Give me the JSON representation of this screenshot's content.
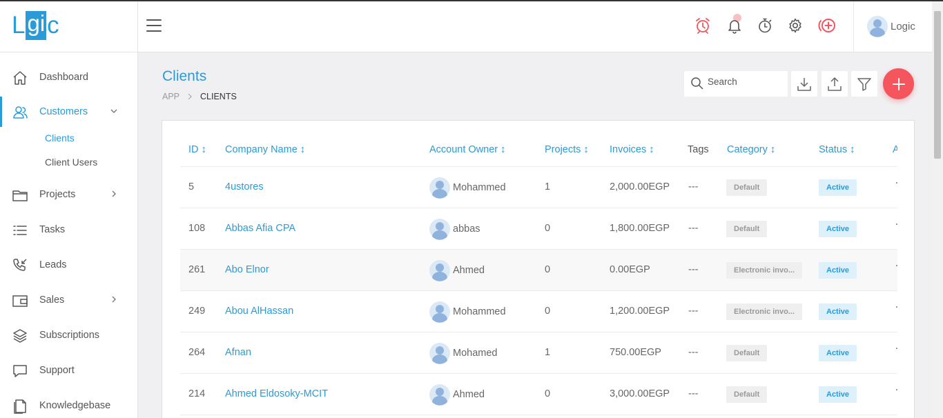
{
  "app": {
    "logo_part1": "L",
    "logo_part2": "gi",
    "logo_part3": "c"
  },
  "header": {
    "user_name": "Logic",
    "icons": [
      "alarm-clock-icon",
      "bell-icon",
      "stopwatch-icon",
      "gear-icon",
      "add-circle-icon"
    ]
  },
  "sidebar": {
    "items": [
      {
        "label": "Dashboard",
        "icon": "home-icon"
      },
      {
        "label": "Customers",
        "icon": "users-icon"
      },
      {
        "label": "Projects",
        "icon": "folder-icon"
      },
      {
        "label": "Tasks",
        "icon": "list-icon"
      },
      {
        "label": "Leads",
        "icon": "phone-icon"
      },
      {
        "label": "Sales",
        "icon": "wallet-icon"
      },
      {
        "label": "Subscriptions",
        "icon": "layers-icon"
      },
      {
        "label": "Support",
        "icon": "chat-icon"
      },
      {
        "label": "Knowledgebase",
        "icon": "book-icon"
      }
    ],
    "sub_items": [
      {
        "label": "Clients"
      },
      {
        "label": "Client Users"
      }
    ]
  },
  "page": {
    "title": "Clients",
    "breadcrumb": [
      "APP",
      "CLIENTS"
    ],
    "search_placeholder": "Search"
  },
  "table": {
    "headers": [
      "ID ↕",
      "Company Name ↕",
      "Account Owner ↕",
      "Projects ↕",
      "Invoices ↕",
      "Tags",
      "Category ↕",
      "Status ↕",
      "A"
    ],
    "rows": [
      {
        "id": "5",
        "company": "4ustores",
        "owner": "Mohammed",
        "projects": "1",
        "invoices": "2,000.00EGP",
        "tags": "---",
        "category": "Default",
        "status": "Active"
      },
      {
        "id": "108",
        "company": "Abbas Afia CPA",
        "owner": "abbas",
        "projects": "0",
        "invoices": "1,800.00EGP",
        "tags": "---",
        "category": "Default",
        "status": "Active"
      },
      {
        "id": "261",
        "company": "Abo Elnor",
        "owner": "Ahmed",
        "projects": "0",
        "invoices": "0.00EGP",
        "tags": "---",
        "category": "Electronic invo...",
        "status": "Active"
      },
      {
        "id": "249",
        "company": "Abou AlHassan",
        "owner": "Mohammed",
        "projects": "0",
        "invoices": "1,200.00EGP",
        "tags": "---",
        "category": "Electronic invo...",
        "status": "Active"
      },
      {
        "id": "264",
        "company": "Afnan",
        "owner": "Mohamed",
        "projects": "1",
        "invoices": "750.00EGP",
        "tags": "---",
        "category": "Default",
        "status": "Active"
      },
      {
        "id": "214",
        "company": "Ahmed Eldosoky-MCIT",
        "owner": "Ahmed",
        "projects": "0",
        "invoices": "3,000.00EGP",
        "tags": "---",
        "category": "Default",
        "status": "Active"
      }
    ]
  },
  "colors": {
    "accent": "#2a9bd6",
    "danger": "#f5555d",
    "status_bg": "#def1fb"
  }
}
